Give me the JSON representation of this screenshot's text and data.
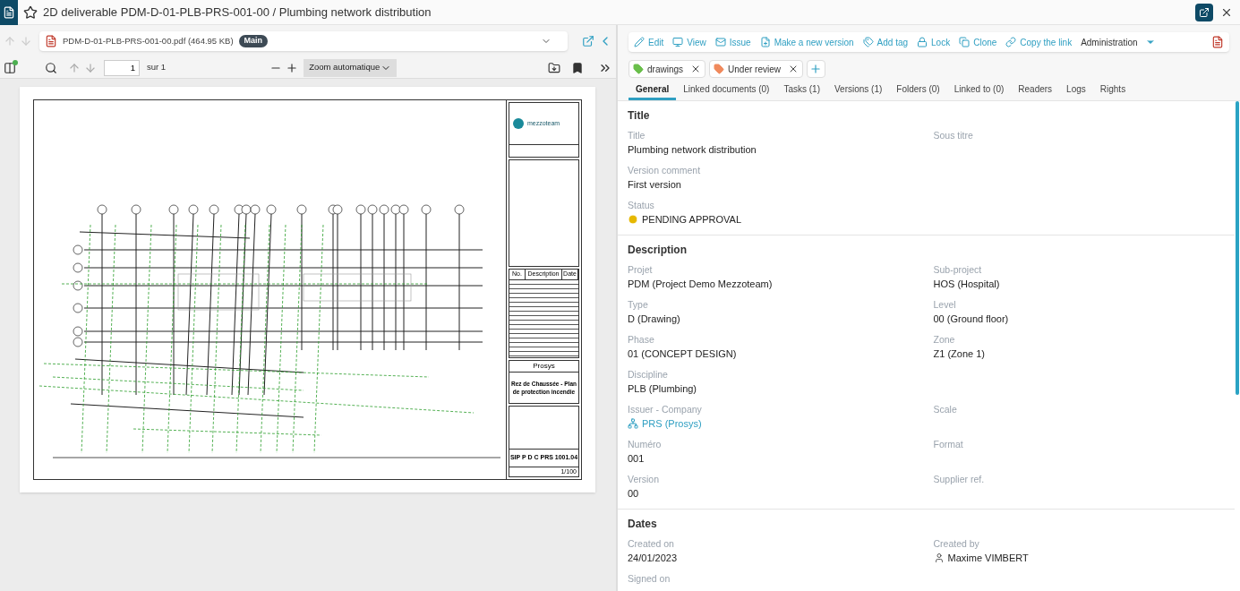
{
  "header": {
    "title": "2D deliverable PDM-D-01-PLB-PRS-001-00 / Plumbing network distribution"
  },
  "viewer": {
    "file_name": "PDM-D-01-PLB-PRS-001-00.pdf (464.95 KB)",
    "badge": "Main",
    "page": "1",
    "page_total": "sur 1",
    "zoom": "Zoom automatique"
  },
  "title_block": {
    "logo": "mezzoteam",
    "revision_columns": [
      "No.",
      "Description",
      "Date"
    ],
    "company": "Prosys",
    "drawing_title": "Rez de Chaussée - Plan de protection incendie",
    "reference": "SIP P D C PRS 1001.04",
    "scale": "1/100"
  },
  "actions": [
    {
      "label": "Edit",
      "kind": "link"
    },
    {
      "label": "View",
      "kind": "link"
    },
    {
      "label": "Issue",
      "kind": "link"
    },
    {
      "label": "Make a new version",
      "kind": "link"
    },
    {
      "label": "Add tag",
      "kind": "link"
    },
    {
      "label": "Lock",
      "kind": "link"
    },
    {
      "label": "Clone",
      "kind": "link"
    },
    {
      "label": "Copy the link",
      "kind": "link"
    },
    {
      "label": "Administration",
      "kind": "menu"
    }
  ],
  "tags": [
    {
      "label": "drawings",
      "color": "#6abf4b"
    },
    {
      "label": "Under review",
      "color": "#f08a5d"
    }
  ],
  "tabs": [
    {
      "label": "General",
      "selected": true
    },
    {
      "label": "Linked documents (0)",
      "selected": false
    },
    {
      "label": "Tasks (1)",
      "selected": false
    },
    {
      "label": "Versions (1)",
      "selected": false
    },
    {
      "label": "Folders (0)",
      "selected": false
    },
    {
      "label": "Linked to (0)",
      "selected": false
    },
    {
      "label": "Readers",
      "selected": false
    },
    {
      "label": "Logs",
      "selected": false
    },
    {
      "label": "Rights",
      "selected": false
    }
  ],
  "sections": [
    {
      "title": "Title",
      "rows": [
        [
          {
            "label": "Title",
            "value": "Plumbing network distribution",
            "kind": "text"
          },
          {
            "label": "Sous titre"
          }
        ],
        [
          {
            "label": "Version comment",
            "value": "First version",
            "kind": "text"
          }
        ],
        [
          {
            "label": "Status",
            "value": "PENDING APPROVAL",
            "kind": "status"
          }
        ]
      ]
    },
    {
      "title": "Description",
      "rows": [
        [
          {
            "label": "Projet",
            "value": "PDM (Project Demo Mezzoteam)",
            "kind": "text"
          },
          {
            "label": "Sub-project",
            "value": "HOS (Hospital)",
            "kind": "text"
          }
        ],
        [
          {
            "label": "Type",
            "value": "D (Drawing)",
            "kind": "text"
          },
          {
            "label": "Level",
            "value": "00 (Ground floor)",
            "kind": "text"
          }
        ],
        [
          {
            "label": "Phase",
            "value": "01 (CONCEPT DESIGN)",
            "kind": "text"
          },
          {
            "label": "Zone",
            "value": "Z1 (Zone 1)",
            "kind": "text"
          }
        ],
        [
          {
            "label": "Discipline",
            "value": "PLB (Plumbing)",
            "kind": "text"
          }
        ],
        [
          {
            "label": "Issuer - Company",
            "value": "PRS (Prosys)",
            "kind": "company"
          },
          {
            "label": "Scale"
          }
        ],
        [
          {
            "label": "Numéro",
            "value": "001",
            "kind": "text"
          },
          {
            "label": "Format"
          }
        ],
        [
          {
            "label": "Version",
            "value": "00",
            "kind": "text"
          },
          {
            "label": "Supplier ref."
          }
        ]
      ]
    },
    {
      "title": "Dates",
      "rows": [
        [
          {
            "label": "Created on",
            "value": "24/01/2023",
            "kind": "text"
          },
          {
            "label": "Created by",
            "value": "Maxime VIMBERT",
            "kind": "user"
          }
        ],
        [
          {
            "label": "Signed on"
          }
        ]
      ]
    }
  ]
}
